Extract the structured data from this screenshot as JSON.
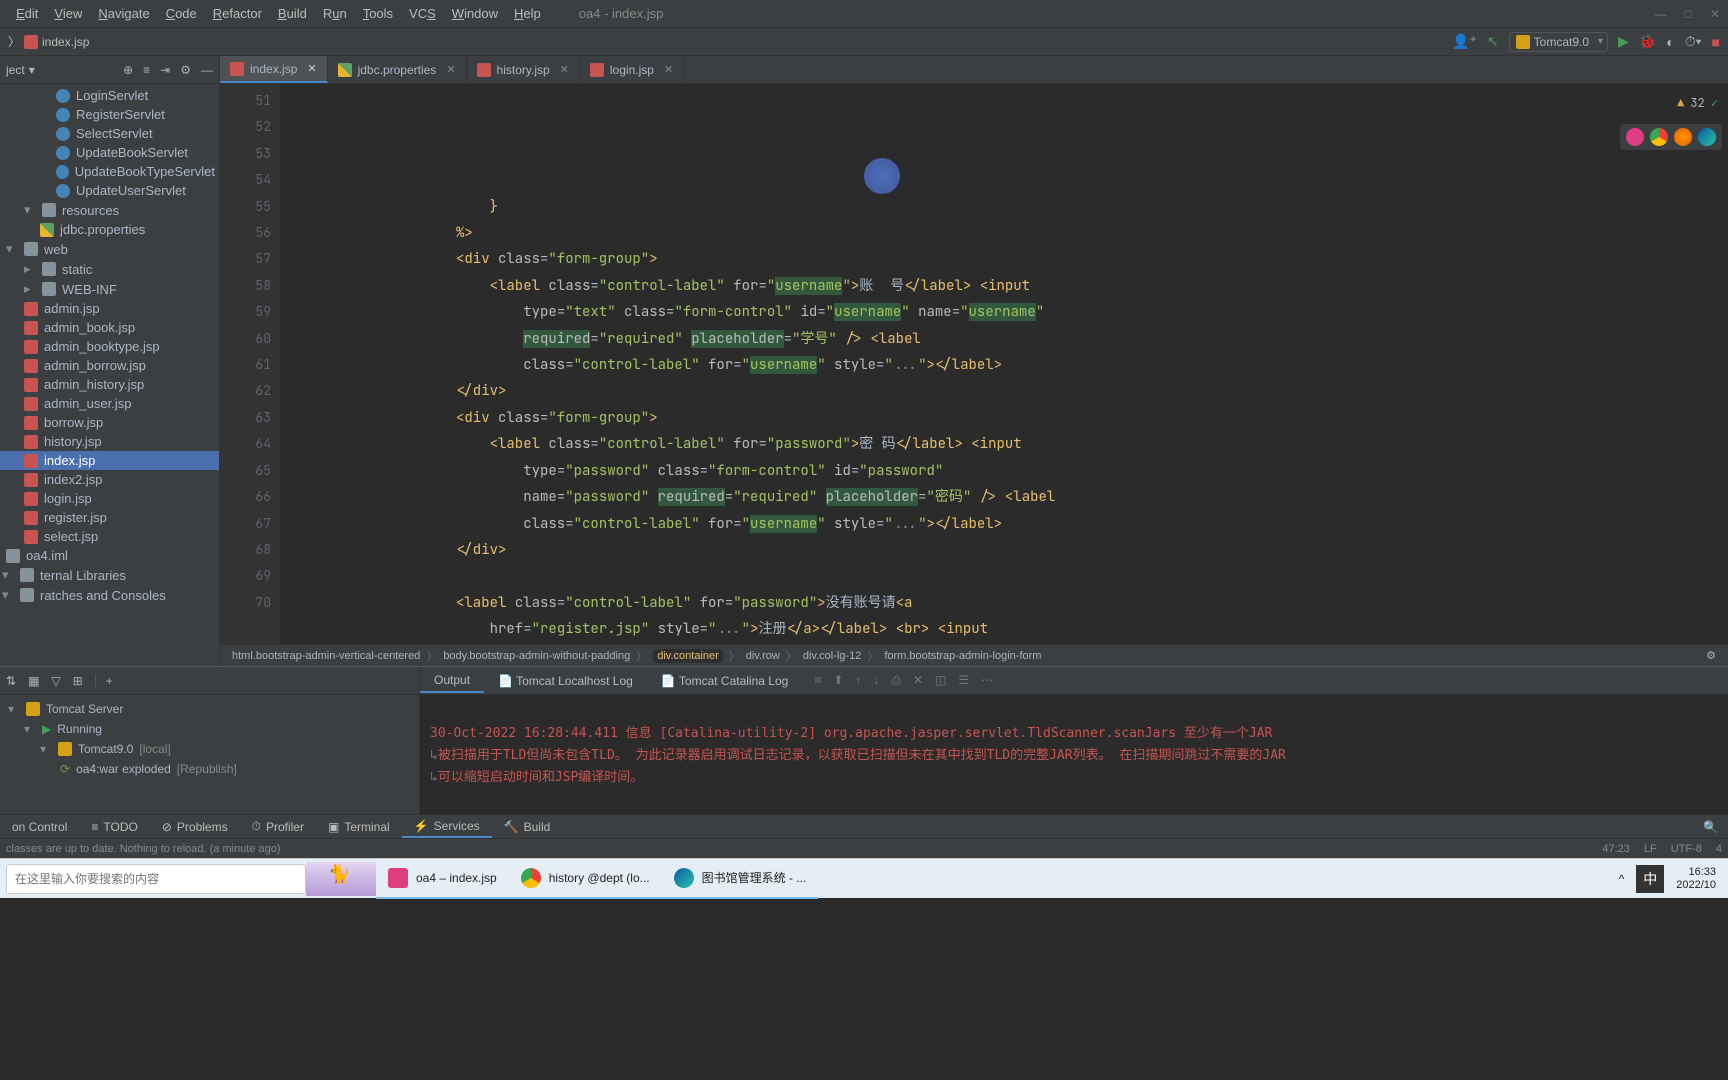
{
  "menu": {
    "items": [
      "Edit",
      "View",
      "Navigate",
      "Code",
      "Refactor",
      "Build",
      "Run",
      "Tools",
      "VCS",
      "Window",
      "Help"
    ],
    "title": "oa4 - index.jsp"
  },
  "breadcrumb": {
    "file": "index.jsp"
  },
  "runConfig": "Tomcat9.0",
  "project": {
    "header": "ject",
    "items": [
      {
        "type": "java",
        "label": "LoginServlet",
        "indent": 3
      },
      {
        "type": "java",
        "label": "RegisterServlet",
        "indent": 3
      },
      {
        "type": "java",
        "label": "SelectServlet",
        "indent": 3
      },
      {
        "type": "java",
        "label": "UpdateBookServlet",
        "indent": 3
      },
      {
        "type": "java",
        "label": "UpdateBookTypeServlet",
        "indent": 3
      },
      {
        "type": "java",
        "label": "UpdateUserServlet",
        "indent": 3
      },
      {
        "type": "folder-open",
        "label": "resources",
        "indent": 1
      },
      {
        "type": "prop",
        "label": "jdbc.properties",
        "indent": 2
      },
      {
        "type": "folder-open",
        "label": "web",
        "indent": 0
      },
      {
        "type": "folder",
        "label": "static",
        "indent": 1
      },
      {
        "type": "folder",
        "label": "WEB-INF",
        "indent": 1
      },
      {
        "type": "jsp",
        "label": "admin.jsp",
        "indent": 1
      },
      {
        "type": "jsp",
        "label": "admin_book.jsp",
        "indent": 1
      },
      {
        "type": "jsp",
        "label": "admin_booktype.jsp",
        "indent": 1
      },
      {
        "type": "jsp",
        "label": "admin_borrow.jsp",
        "indent": 1
      },
      {
        "type": "jsp",
        "label": "admin_history.jsp",
        "indent": 1
      },
      {
        "type": "jsp",
        "label": "admin_user.jsp",
        "indent": 1
      },
      {
        "type": "jsp",
        "label": "borrow.jsp",
        "indent": 1
      },
      {
        "type": "jsp",
        "label": "history.jsp",
        "indent": 1
      },
      {
        "type": "jsp",
        "label": "index.jsp",
        "indent": 1,
        "selected": true
      },
      {
        "type": "jsp",
        "label": "index2.jsp",
        "indent": 1
      },
      {
        "type": "jsp",
        "label": "login.jsp",
        "indent": 1
      },
      {
        "type": "jsp",
        "label": "register.jsp",
        "indent": 1
      },
      {
        "type": "jsp",
        "label": "select.jsp",
        "indent": 1
      },
      {
        "type": "iml",
        "label": "oa4.iml",
        "indent": 0
      },
      {
        "type": "lib",
        "label": "ternal Libraries",
        "indent": -1
      },
      {
        "type": "scratch",
        "label": "ratches and Consoles",
        "indent": -1
      }
    ]
  },
  "editorTabs": [
    {
      "label": "index.jsp",
      "active": true
    },
    {
      "label": "jdbc.properties"
    },
    {
      "label": "history.jsp"
    },
    {
      "label": "login.jsp"
    }
  ],
  "warnings": "32",
  "gutter": [
    "51",
    "52",
    "53",
    "54",
    "55",
    "56",
    "57",
    "58",
    "59",
    "60",
    "61",
    "62",
    "63",
    "64",
    "65",
    "66",
    "67",
    "68",
    "69",
    "70"
  ],
  "editorBreadcrumb": [
    "html.bootstrap-admin-vertical-centered",
    "body.bootstrap-admin-without-padding",
    "div.container",
    "div.row",
    "div.col-lg-12",
    "form.bootstrap-admin-login-form"
  ],
  "toolTabs": {
    "output": "Output",
    "localhost": "Tomcat Localhost Log",
    "catalina": "Tomcat Catalina Log"
  },
  "tomcatTree": {
    "server": "Tomcat Server",
    "running": "Running",
    "config": "Tomcat9.0",
    "configTag": "[local]",
    "artifact": "oa4:war exploded",
    "artifactTag": "[Republish]"
  },
  "console": {
    "l1": "30-Oct-2022 16:28:44.411 信息 [Catalina-utility-2] org.apache.jasper.servlet.TldScanner.scanJars 至少有一个JAR",
    "l2": "被扫描用于TLD但尚未包含TLD。 为此记录器启用调试日志记录，以获取已扫描但未在其中找到TLD的完整JAR列表。 在扫描期间跳过不需要的JAR",
    "l3": "可以缩短启动时间和JSP编译时间。"
  },
  "bottomTabs": {
    "control": "on Control",
    "todo": "TODO",
    "problems": "Problems",
    "profiler": "Profiler",
    "terminal": "Terminal",
    "services": "Services",
    "build": "Build"
  },
  "statusMsg": "classes are up to date. Nothing to reload. (a minute ago)",
  "statusRight": {
    "pos": "47:23",
    "eol": "LF",
    "enc": "UTF-8",
    "ind": "4"
  },
  "search": {
    "placeholder": "在这里输入你要搜索的内容"
  },
  "taskbar": [
    {
      "label": "oa4 – index.jsp",
      "icon": "ij",
      "active": true
    },
    {
      "label": "history @dept (lo...",
      "icon": "chrome",
      "active": true
    },
    {
      "label": "图书馆管理系统 - ...",
      "icon": "edge",
      "active": true
    }
  ],
  "tray": {
    "ime": "中",
    "time": "16:33",
    "date": "2022/10"
  }
}
